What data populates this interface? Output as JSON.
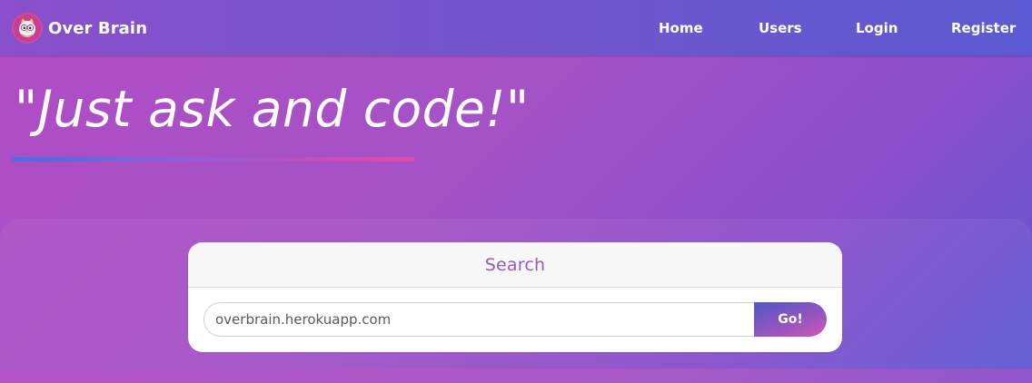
{
  "navbar": {
    "brand": {
      "logo_icon": "owl-logo-icon",
      "name": "Over Brain"
    },
    "links": [
      {
        "label": "Home"
      },
      {
        "label": "Users"
      },
      {
        "label": "Login"
      },
      {
        "label": "Register"
      }
    ]
  },
  "hero": {
    "title": "\"Just ask and code!\""
  },
  "search": {
    "title": "Search",
    "input_value": "overbrain.herokuapp.com",
    "button_label": "Go!"
  },
  "colors": {
    "navbar_start": "#8a4fcb",
    "navbar_end": "#5c5ad2",
    "background_start": "#b14cc5",
    "background_end": "#5d58d3",
    "search_title": "#9a55c4",
    "logo_bg": "#c83e93"
  }
}
